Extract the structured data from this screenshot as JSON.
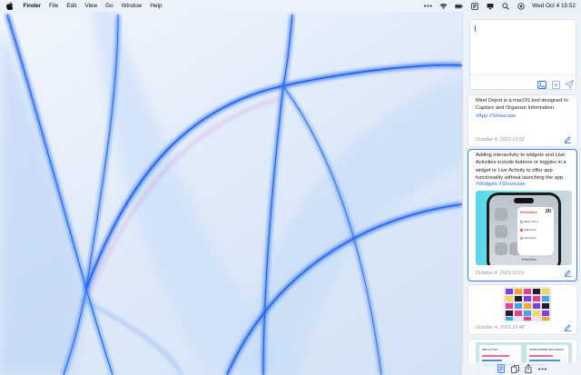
{
  "menubar": {
    "apple_icon": "apple-logo-icon",
    "app_name": "Finder",
    "menus": [
      "File",
      "Edit",
      "View",
      "Go",
      "Window",
      "Help"
    ],
    "status_icons": [
      "more-icon",
      "wifi-icon",
      "battery-icon",
      "notes-app-icon",
      "display-icon",
      "search-icon",
      "control-center-icon"
    ],
    "clock": "Wed Oct 4  15:52"
  },
  "panel": {
    "composer": {
      "buttons": [
        "image-icon",
        "clear-icon",
        "send-icon"
      ]
    },
    "notes": [
      {
        "text": "Mind Depot is a macOS tool designed to Capture and Organize Information.",
        "tags": "#App #Showcase",
        "date": "October 4, 2023  15:52"
      },
      {
        "text": "Adding interactivity to widgets and Live Activities include buttons or toggles in a widget or Live Activity to offer app functionality without launching the app.",
        "tags": "#Widgets #Showcase",
        "date": "October 4, 2023  10:01",
        "preview": {
          "widget_title": "Reminders",
          "widget_count": "20",
          "rows": [
            "Water the it",
            "Call Kevin",
            "Announce"
          ],
          "footer": "Feed Anne"
        }
      },
      {
        "date": "October 4, 2023  15:48"
      },
      {
        "preview_titles": [
          "Item to Cart",
          "Invite member and connec"
        ]
      }
    ]
  },
  "toolbar": {
    "buttons": [
      "notes-icon",
      "copy-icon",
      "share-icon",
      "more-icon"
    ]
  },
  "colors": {
    "accent": "#2f6fe0",
    "selected_border": "#3b7fe6",
    "panel_bg": "#eef3f9"
  }
}
